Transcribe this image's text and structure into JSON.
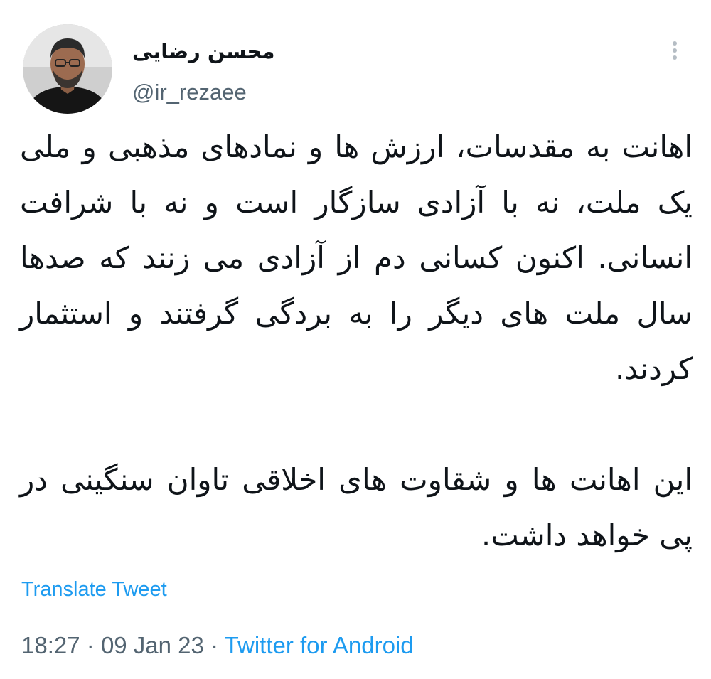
{
  "user": {
    "display_name": "محسن رضایی",
    "handle": "@ir_rezaee",
    "avatar_icon": "profile-photo"
  },
  "menu": {
    "more_icon": "more-vertical-icon"
  },
  "tweet": {
    "paragraphs": [
      "اهانت به مقدسات، ارزش ها و نمادهای مذهبی و ملی یک ملت، نه با آزادی سازگار است و نه با شرافت انسانی. اکنون کسانی دم از آزادی می زنند که صدها سال ملت های دیگر را به بردگی گرفتند و استثمار کردند.",
      "این اهانت ها و شقاوت های اخلاقی تاوان سنگینی در پی خواهد داشت."
    ],
    "translate_label": "Translate Tweet"
  },
  "meta": {
    "time": "18:27",
    "separator": "·",
    "date": "09 Jan 23",
    "source": "Twitter for Android"
  },
  "colors": {
    "link": "#1d9bf0",
    "secondary_text": "#536471",
    "primary_text": "#0f1419"
  }
}
